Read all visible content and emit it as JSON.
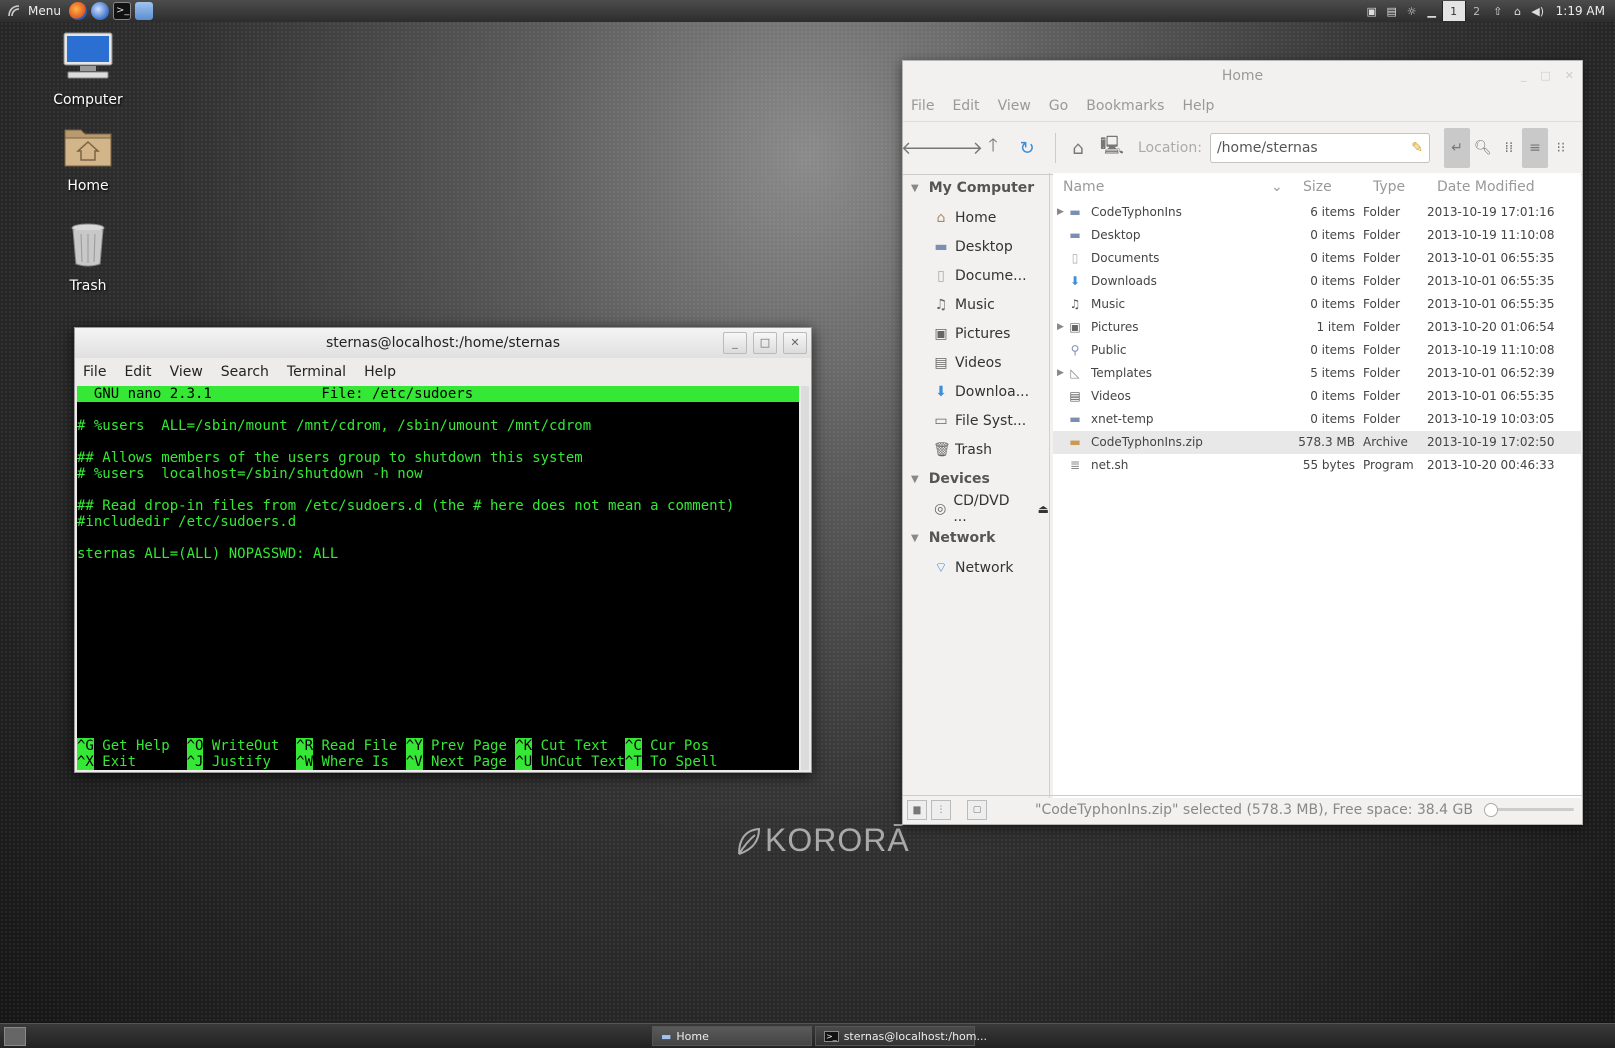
{
  "top_panel": {
    "menu_label": "Menu",
    "workspaces": [
      "1",
      "2"
    ],
    "active_workspace": "1",
    "clock": "1:19 AM",
    "launchers": [
      "firefox-icon",
      "thunderbird-icon",
      "terminal-icon",
      "files-icon"
    ]
  },
  "desktop": {
    "icons": [
      {
        "label": "Computer",
        "icon": "computer-icon"
      },
      {
        "label": "Home",
        "icon": "home-folder-icon"
      },
      {
        "label": "Trash",
        "icon": "trash-icon"
      }
    ],
    "logo_text": "KORORĀ"
  },
  "terminal": {
    "title": "sternas@localhost:/home/sternas",
    "menu": [
      "File",
      "Edit",
      "View",
      "Search",
      "Terminal",
      "Help"
    ],
    "nano_header": "  GNU nano 2.3.1             File: /etc/sudoers",
    "lines": [
      "",
      "# %users  ALL=/sbin/mount /mnt/cdrom, /sbin/umount /mnt/cdrom",
      "",
      "## Allows members of the users group to shutdown this system",
      "# %users  localhost=/sbin/shutdown -h now",
      "",
      "## Read drop-in files from /etc/sudoers.d (the # here does not mean a comment)",
      "#includedir /etc/sudoers.d",
      "",
      "sternas ALL=(ALL) NOPASSWD: ALL"
    ],
    "shortcuts_row1": [
      {
        "key": "^G",
        "label": " Get Help  "
      },
      {
        "key": "^O",
        "label": " WriteOut  "
      },
      {
        "key": "^R",
        "label": " Read File "
      },
      {
        "key": "^Y",
        "label": " Prev Page "
      },
      {
        "key": "^K",
        "label": " Cut Text  "
      },
      {
        "key": "^C",
        "label": " Cur Pos"
      }
    ],
    "shortcuts_row2": [
      {
        "key": "^X",
        "label": " Exit      "
      },
      {
        "key": "^J",
        "label": " Justify   "
      },
      {
        "key": "^W",
        "label": " Where Is  "
      },
      {
        "key": "^V",
        "label": " Next Page "
      },
      {
        "key": "^U",
        "label": " UnCut Text"
      },
      {
        "key": "^T",
        "label": " To Spell"
      }
    ]
  },
  "file_manager": {
    "title": "Home",
    "menu": [
      "File",
      "Edit",
      "View",
      "Go",
      "Bookmarks",
      "Help"
    ],
    "location_label": "Location:",
    "location_value": "/home/sternas",
    "sidebar": {
      "my_computer_header": "My Computer",
      "my_computer": [
        {
          "label": "Home",
          "icon": "home-icon"
        },
        {
          "label": "Desktop",
          "icon": "desktop-icon"
        },
        {
          "label": "Docume...",
          "icon": "documents-icon"
        },
        {
          "label": "Music",
          "icon": "music-icon"
        },
        {
          "label": "Pictures",
          "icon": "pictures-icon"
        },
        {
          "label": "Videos",
          "icon": "videos-icon"
        },
        {
          "label": "Downloa...",
          "icon": "downloads-icon"
        },
        {
          "label": "File Syst...",
          "icon": "filesystem-icon"
        },
        {
          "label": "Trash",
          "icon": "trash-icon"
        }
      ],
      "devices_header": "Devices",
      "devices": [
        {
          "label": "CD/DVD ...",
          "icon": "cdrom-icon"
        }
      ],
      "network_header": "Network",
      "network": [
        {
          "label": "Network",
          "icon": "network-icon"
        }
      ]
    },
    "columns": {
      "name": "Name",
      "size": "Size",
      "type": "Type",
      "date": "Date Modified"
    },
    "files": [
      {
        "name": "CodeTyphonIns",
        "size": "6 items",
        "type": "Folder",
        "date": "2013-10-19 17:01:16",
        "expander": true,
        "icon": "folder-icon"
      },
      {
        "name": "Desktop",
        "size": "0 items",
        "type": "Folder",
        "date": "2013-10-19 11:10:08",
        "expander": false,
        "icon": "folder-icon"
      },
      {
        "name": "Documents",
        "size": "0 items",
        "type": "Folder",
        "date": "2013-10-01 06:55:35",
        "expander": false,
        "icon": "documents-icon"
      },
      {
        "name": "Downloads",
        "size": "0 items",
        "type": "Folder",
        "date": "2013-10-01 06:55:35",
        "expander": false,
        "icon": "downloads-icon"
      },
      {
        "name": "Music",
        "size": "0 items",
        "type": "Folder",
        "date": "2013-10-01 06:55:35",
        "expander": false,
        "icon": "music-icon"
      },
      {
        "name": "Pictures",
        "size": "1 item",
        "type": "Folder",
        "date": "2013-10-20 01:06:54",
        "expander": true,
        "icon": "pictures-icon"
      },
      {
        "name": "Public",
        "size": "0 items",
        "type": "Folder",
        "date": "2013-10-19 11:10:08",
        "expander": false,
        "icon": "public-icon"
      },
      {
        "name": "Templates",
        "size": "5 items",
        "type": "Folder",
        "date": "2013-10-01 06:52:39",
        "expander": true,
        "icon": "templates-icon"
      },
      {
        "name": "Videos",
        "size": "0 items",
        "type": "Folder",
        "date": "2013-10-01 06:55:35",
        "expander": false,
        "icon": "videos-icon"
      },
      {
        "name": "xnet-temp",
        "size": "0 items",
        "type": "Folder",
        "date": "2013-10-19 10:03:05",
        "expander": false,
        "icon": "folder-icon"
      },
      {
        "name": "CodeTyphonIns.zip",
        "size": "578.3 MB",
        "type": "Archive",
        "date": "2013-10-19 17:02:50",
        "expander": false,
        "icon": "archive-icon",
        "selected": true
      },
      {
        "name": "net.sh",
        "size": "55 bytes",
        "type": "Program",
        "date": "2013-10-20 00:46:33",
        "expander": false,
        "icon": "script-icon"
      }
    ],
    "status": "\"CodeTyphonIns.zip\" selected (578.3 MB), Free space: 38.4 GB"
  },
  "taskbar": {
    "tasks": [
      {
        "label": "Home",
        "icon": "folder-icon"
      },
      {
        "label": "sternas@localhost:/hom...",
        "icon": "terminal-icon"
      }
    ]
  },
  "colors": {
    "terminal_green": "#35e835",
    "terminal_bg": "#000000",
    "window_bg": "#f2f1f0"
  }
}
